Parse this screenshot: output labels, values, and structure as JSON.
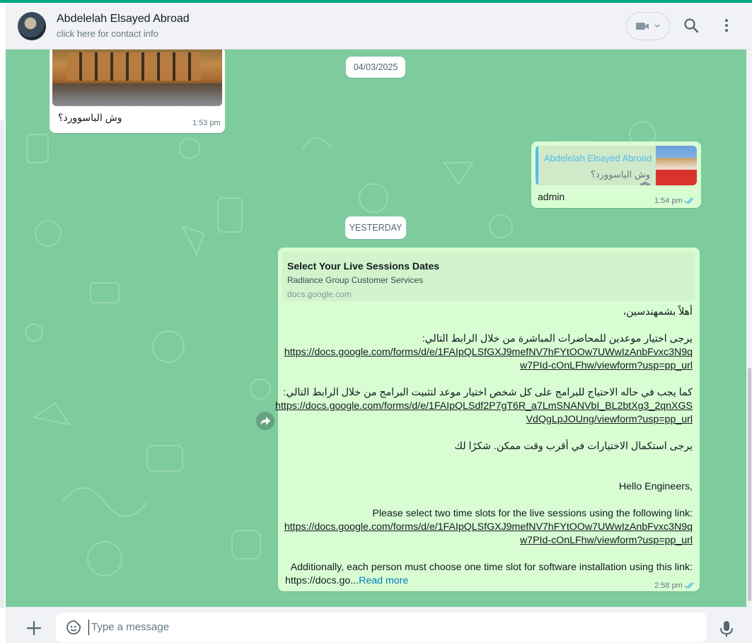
{
  "header": {
    "contact_name": "Abdelelah Elsayed Abroad",
    "contact_sub": "click here for contact info"
  },
  "chat": {
    "msg1": {
      "caption": "وش الباسوورد؟",
      "time": "1:53 pm"
    },
    "date1": "04/03/2025",
    "msg2": {
      "quote_author": "Abdelelah Elsayed Abroad",
      "quote_text": "وش الباسوورد؟",
      "text": "admin",
      "time": "1:54 pm"
    },
    "date2": "YESTERDAY",
    "msg3": {
      "preview_title": "Select Your Live Sessions Dates",
      "preview_desc": "Radiance Group Customer Services",
      "preview_domain": "docs.google.com",
      "ar_greeting": "أهلاً بشمهندسين،",
      "ar_line1": "يرجى اختيار موعدين للمحاضرات المباشرة من خلال الرابط التالي:",
      "link1_a": "https://docs.google.com/forms/d/e/1FAIpQLSfGXJ9mefNV7hFYtOOw7UWwIzAnbFvxc3N9q",
      "link1_b": "w7PId-cOnLFhw/viewform?usp=pp_url",
      "ar_line2": "كما يجب في حاله الاحتياج للبرامج على كل شخص اختيار موعد لتثبيت  البرامج من خلال الرابط التالي:",
      "link2_a": "https://docs.google.com/forms/d/e/1FAIpQLSdf2P7gT6R_a7LmSNANVbI_BL2btXg3_2qnXGS",
      "link2_b": "VdQgLpJOUng/viewform?usp=pp_url",
      "ar_line3": "يرجى استكمال الاختيارات في أقرب وقت ممكن. شكرًا لك",
      "en_greeting": "Hello Engineers,",
      "en_line1": "Please select two time slots for the live sessions using the following link:",
      "link3_a": "https://docs.google.com/forms/d/e/1FAIpQLSfGXJ9mefNV7hFYtOOw7UWwIzAnbFvxc3N9q",
      "link3_b": "w7PId-cOnLFhw/viewform?usp=pp_url",
      "en_line2": "Additionally, each person must choose one time slot for software installation using this link:",
      "en_trunc": "https://docs.go...",
      "read_more": "Read more",
      "time": "2:58 pm"
    }
  },
  "footer": {
    "placeholder": "Type a message"
  },
  "colors": {
    "accent": "#00a884",
    "chat_bg": "#7ecb9e",
    "outgoing": "#d9fdd3",
    "link": "#027eb5",
    "read_ticks": "#53bdeb"
  },
  "icons": [
    "video-call-icon",
    "search-icon",
    "menu-icon",
    "forward-icon",
    "plus-icon",
    "sticker-icon",
    "mic-icon",
    "camera-icon",
    "double-check-icon"
  ]
}
